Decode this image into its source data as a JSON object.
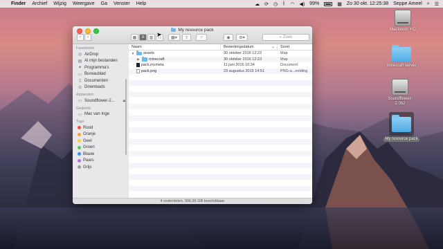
{
  "menubar": {
    "app": "Finder",
    "menus": [
      "Archief",
      "Wijzig",
      "Weergave",
      "Ga",
      "Venster",
      "Help"
    ],
    "battery": "99%",
    "datetime": "Zo 30 okt.  12:25:38",
    "user": "Seppe Ameel"
  },
  "window": {
    "title": "My resource pack",
    "search_placeholder": "Zoek",
    "status": "4 onderdelen, 906,95 GB beschikbaar"
  },
  "sidebar": {
    "sections": [
      {
        "header": "Favorieten",
        "items": [
          {
            "label": "AirDrop",
            "icon": "airdrop-icon"
          },
          {
            "label": "Al mijn bestanden",
            "icon": "all-files-icon"
          },
          {
            "label": "Programma's",
            "icon": "applications-icon"
          },
          {
            "label": "Bureaublad",
            "icon": "desktop-icon"
          },
          {
            "label": "Documenten",
            "icon": "documents-icon"
          },
          {
            "label": "Downloads",
            "icon": "downloads-icon"
          }
        ]
      },
      {
        "header": "Apparaten",
        "items": [
          {
            "label": "Soundflower-2...",
            "icon": "disk-icon"
          }
        ]
      },
      {
        "header": "Gedeeld",
        "items": [
          {
            "label": "Mac van Inge",
            "icon": "computer-icon"
          }
        ]
      },
      {
        "header": "Tags",
        "items": [
          {
            "label": "Rood",
            "color": "#f3504c"
          },
          {
            "label": "Oranje",
            "color": "#f7a03a"
          },
          {
            "label": "Geel",
            "color": "#f6d33c"
          },
          {
            "label": "Groen",
            "color": "#5ec65a"
          },
          {
            "label": "Blauw",
            "color": "#3b8ef1"
          },
          {
            "label": "Paars",
            "color": "#b26fd6"
          },
          {
            "label": "Grijs",
            "color": "#9a9a9a"
          }
        ]
      }
    ]
  },
  "columns": {
    "name": "Naam",
    "date": "Bewerkingsdatum",
    "kind": "Soort"
  },
  "files": [
    {
      "name": "assets",
      "date": "30 oktober 2016 12:23",
      "kind": "Map",
      "type": "folder",
      "disclosure": "▼",
      "indent": 0
    },
    {
      "name": "minecraft",
      "date": "30 oktober 2016 12:23",
      "kind": "Map",
      "type": "folder",
      "disclosure": "▶",
      "indent": 1
    },
    {
      "name": "pack.mcmeta",
      "date": "11 juni 2016 10:34",
      "kind": "Document",
      "type": "doc",
      "disclosure": "",
      "indent": 0
    },
    {
      "name": "pack.png",
      "date": "23 augustus 2015 14:51",
      "kind": "PNG-a...eelding",
      "type": "png",
      "disclosure": "",
      "indent": 0
    }
  ],
  "desktop": [
    {
      "label": "Macintosh HD",
      "kind": "hd"
    },
    {
      "label": "minecraft server",
      "kind": "folder"
    },
    {
      "label": "Soundflower-2.0b2",
      "kind": "hd"
    },
    {
      "label": "My resource pack",
      "kind": "folder",
      "selected": true
    }
  ]
}
